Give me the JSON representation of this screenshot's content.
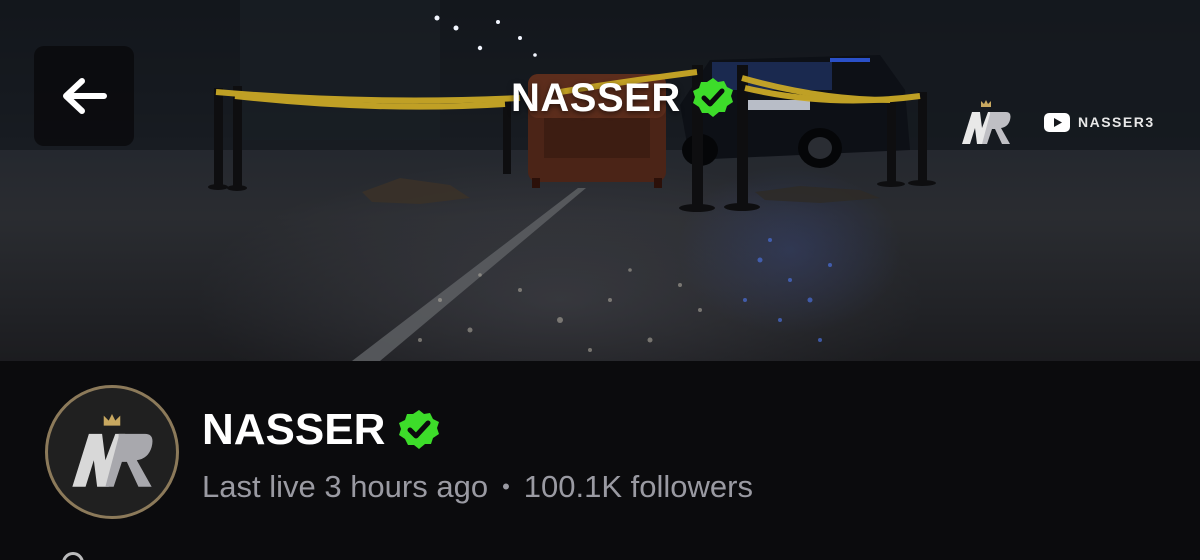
{
  "banner": {
    "title": "NASSER",
    "verified": true,
    "youtube_label": "NASSER3"
  },
  "channel": {
    "name": "NASSER",
    "verified": true,
    "last_live": "Last live 3 hours ago",
    "separator": "•",
    "followers": "100.1K followers"
  },
  "icons": {
    "back": "arrow-left-icon",
    "verified": "verified-badge-icon",
    "youtube": "youtube-icon",
    "logo": "nr-logo-icon"
  },
  "colors": {
    "verified_green": "#3ddc2a",
    "avatar_ring": "#8c7a5a",
    "page_bg": "#0b0b0d",
    "meta_text": "#9a9aa2",
    "tape_yellow": "#c9a826"
  }
}
